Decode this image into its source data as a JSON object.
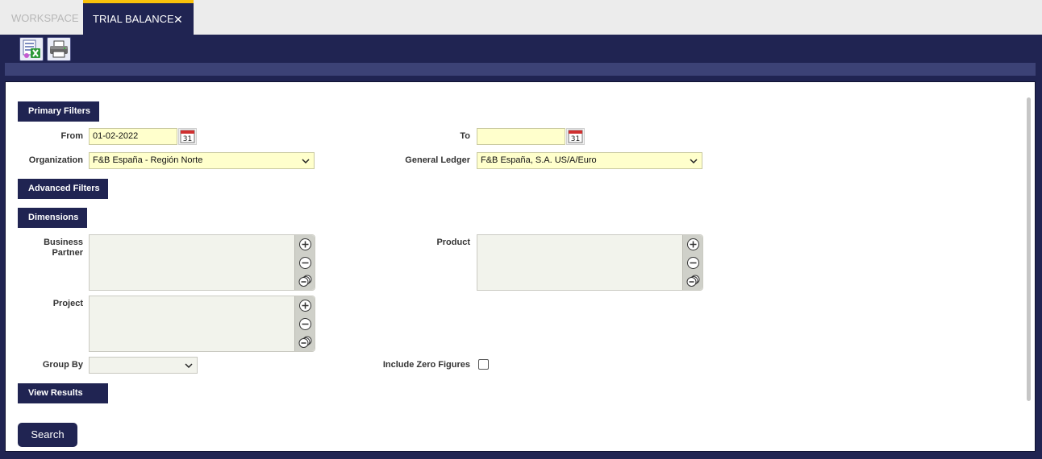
{
  "tabs": {
    "workspace": "WORKSPACE",
    "trial_balance": "TRIAL BALANCE",
    "close_glyph": "✕"
  },
  "toolbar": {
    "export_excel_icon": "excel-export-icon",
    "print_icon": "printer-icon"
  },
  "sections": {
    "primary": "Primary Filters",
    "advanced": "Advanced Filters",
    "dimensions": "Dimensions",
    "results": "View Results"
  },
  "fields": {
    "from_label": "From",
    "from_value": "01-02-2022",
    "to_label": "To",
    "to_value": "",
    "calendar_glyph": "31",
    "organization_label": "Organization",
    "organization_value": "F&B España - Región Norte",
    "general_ledger_label": "General Ledger",
    "general_ledger_value": "F&B España, S.A. US/A/Euro",
    "business_partner_label": "Business Partner",
    "product_label": "Product",
    "project_label": "Project",
    "group_by_label": "Group By",
    "group_by_value": "",
    "include_zero_label": "Include Zero Figures",
    "include_zero_checked": false
  },
  "search_button": "Search",
  "colors": {
    "navy": "#202452",
    "accent_yellow": "#f9c10b",
    "input_yellow": "#ffffcc"
  }
}
